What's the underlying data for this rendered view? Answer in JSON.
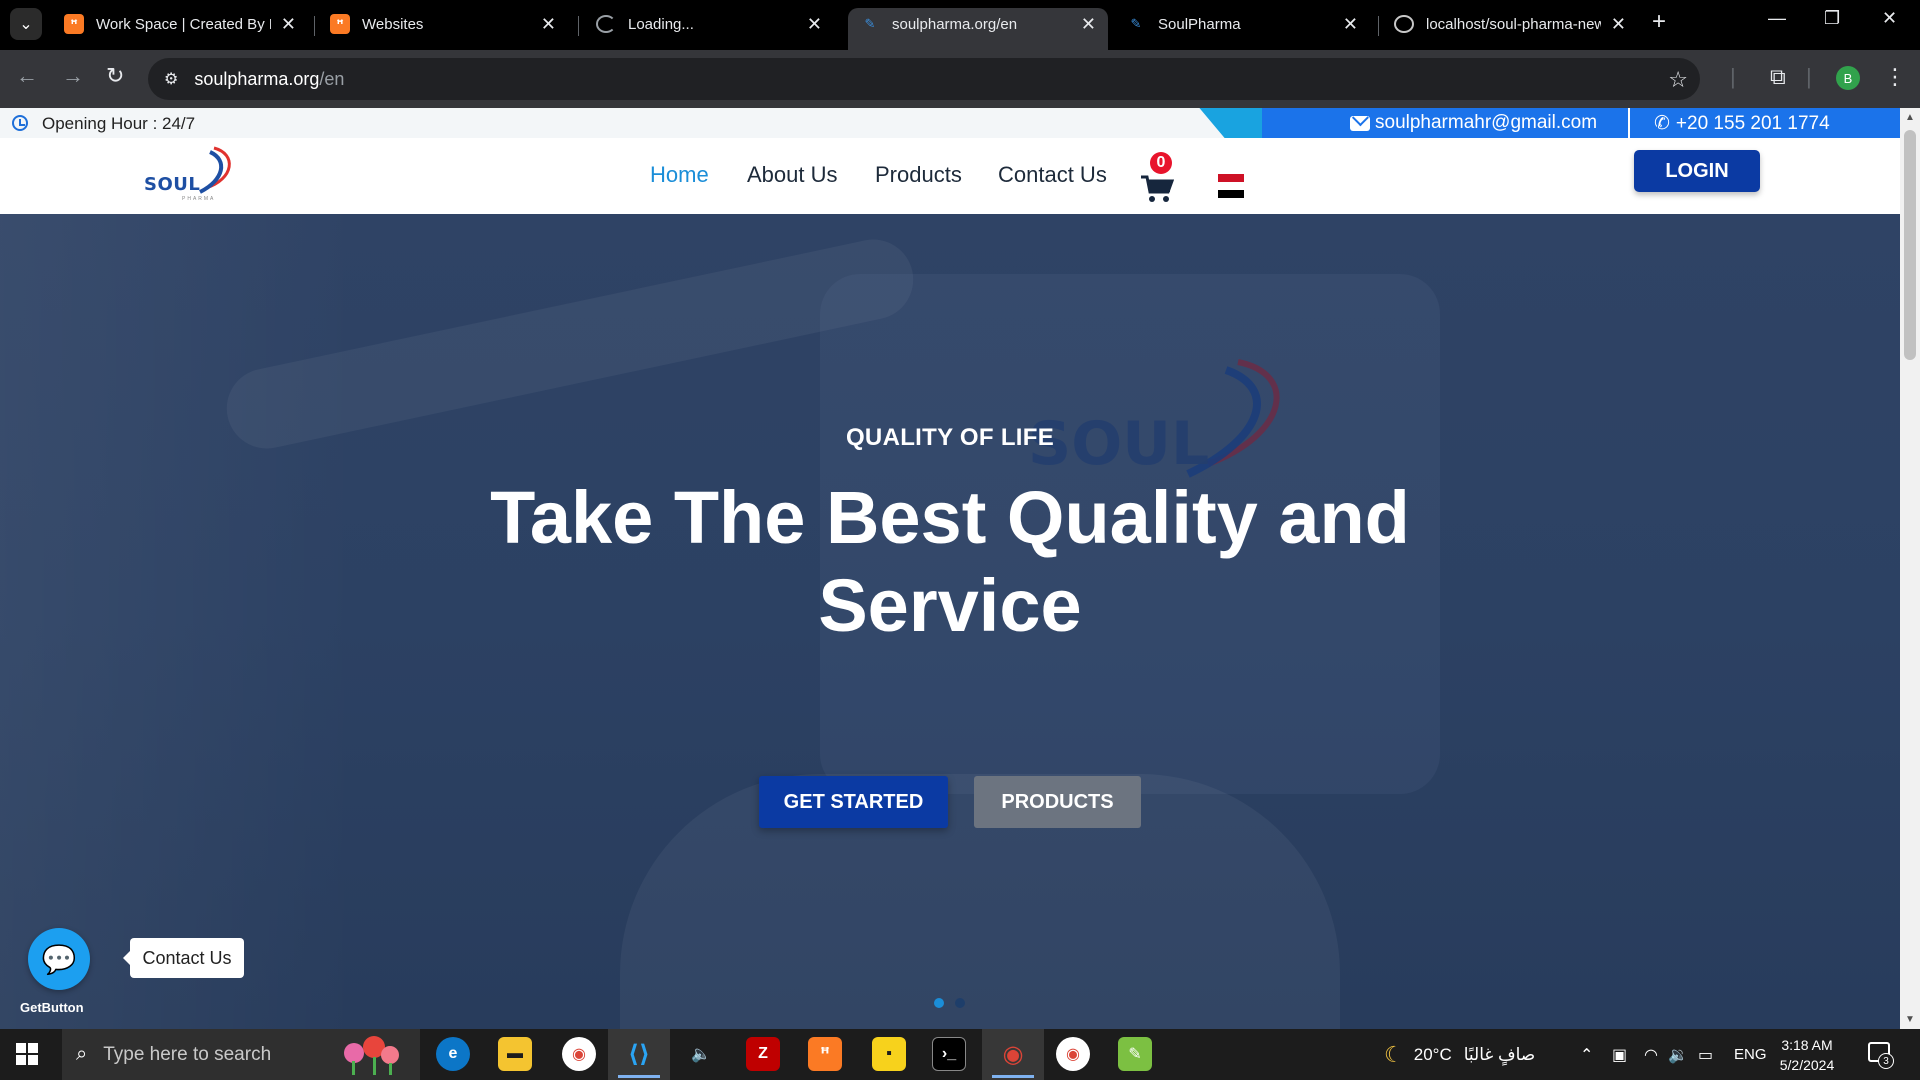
{
  "browser": {
    "tabs": [
      {
        "title": "Work Space | Created By Er",
        "favicon": "xampp-icon",
        "active": false
      },
      {
        "title": "Websites",
        "favicon": "xampp-icon",
        "active": false
      },
      {
        "title": "Loading...",
        "favicon": "loading-spinner-icon",
        "active": false
      },
      {
        "title": "soulpharma.org/en",
        "favicon": "soul-pharma-icon",
        "active": true
      },
      {
        "title": "SoulPharma",
        "favicon": "soul-pharma-icon",
        "active": false
      },
      {
        "title": "localhost/soul-pharma-new",
        "favicon": "globe-icon",
        "active": false
      }
    ],
    "address": {
      "host": "soulpharma.org",
      "path": "/en"
    },
    "profile_initial": "B"
  },
  "topbar": {
    "opening_hours": "Opening Hour : 24/7",
    "email": "soulpharmahr@gmail.com",
    "phone": "+20 155 201 1774"
  },
  "navbar": {
    "logo_text": "SOUL",
    "logo_sub": "PHARMA",
    "links": [
      {
        "label": "Home",
        "active": true
      },
      {
        "label": "About Us",
        "active": false
      },
      {
        "label": "Products",
        "active": false
      },
      {
        "label": "Contact Us",
        "active": false
      }
    ],
    "cart_count": "0",
    "language_flag": "egypt-flag-icon",
    "login_label": "LOGIN"
  },
  "hero": {
    "subtitle": "QUALITY OF LIFE",
    "title": "Take The Best Quality and Service",
    "primary_button": "GET STARTED",
    "secondary_button": "PRODUCTS",
    "watermark_text": "SOUL",
    "slide_count": 2,
    "active_slide": 1
  },
  "getbutton": {
    "label": "Contact Us",
    "brand": "GetButton"
  },
  "taskbar": {
    "search_placeholder": "Type here to search",
    "weather_temp": "20°C",
    "weather_text": "صافٍ غالبًا",
    "language": "ENG",
    "time": "3:18 AM",
    "date": "5/2/2024",
    "notification_count": "3"
  },
  "colors": {
    "brand_blue": "#0b3aa3",
    "accent_blue": "#1b73ea",
    "nav_active": "#1b8ed8",
    "hero_bg": "#2c4163",
    "badge_red": "#e8142c"
  }
}
